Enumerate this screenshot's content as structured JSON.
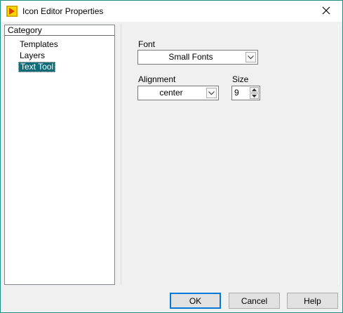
{
  "window": {
    "title": "Icon Editor Properties",
    "icons": {
      "app": "labview-icon",
      "close": "close-icon"
    },
    "colors": {
      "border": "#1f8f86",
      "selection": "#0f6b77",
      "default_button": "#0078d7"
    }
  },
  "category": {
    "header": "Category",
    "items": [
      {
        "label": "Templates",
        "selected": false
      },
      {
        "label": "Layers",
        "selected": false
      },
      {
        "label": "Text Tool",
        "selected": true
      }
    ]
  },
  "text_tool": {
    "font_label": "Font",
    "font_value": "Small Fonts",
    "alignment_label": "Alignment",
    "alignment_value": "center",
    "size_label": "Size",
    "size_value": "9"
  },
  "buttons": {
    "ok": "OK",
    "cancel": "Cancel",
    "help": "Help"
  }
}
